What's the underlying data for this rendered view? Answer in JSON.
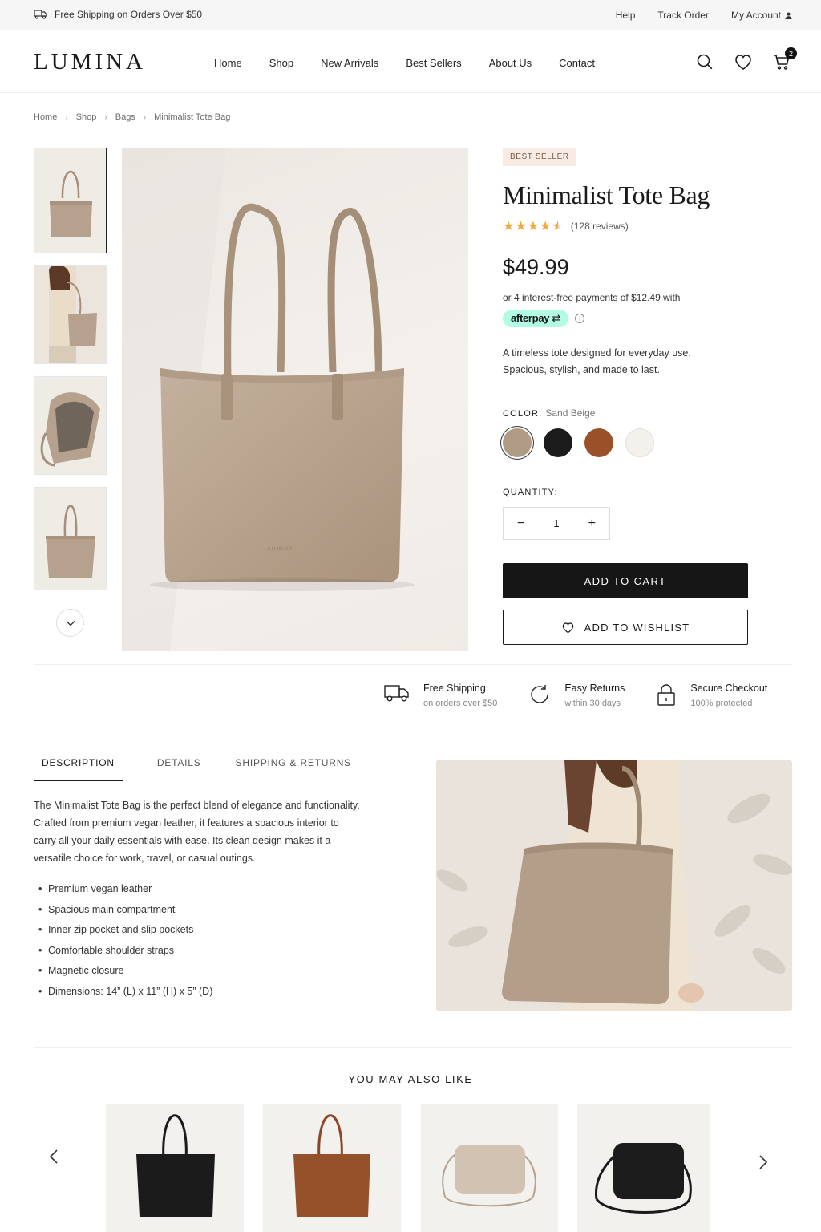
{
  "topbar": {
    "shipping_text": "Free Shipping on Orders Over $50",
    "links": [
      "Help",
      "Track Order",
      "My Account"
    ]
  },
  "header": {
    "logo": "LUMINA",
    "nav": [
      "Home",
      "Shop",
      "New Arrivals",
      "Best Sellers",
      "About Us",
      "Contact"
    ],
    "cart_count": "2"
  },
  "breadcrumb": [
    "Home",
    "Shop",
    "Bags",
    "Minimalist Tote Bag"
  ],
  "product": {
    "badge": "BEST SELLER",
    "title": "Minimalist Tote Bag",
    "rating": 4.5,
    "reviews": "(128 reviews)",
    "price": "$49.99",
    "payments": "or 4 interest-free payments of $12.49 with",
    "afterpay_label": "afterpay",
    "description_line1": "A timeless tote designed for everyday use.",
    "description_line2": "Spacious, stylish, and made to last.",
    "color_label": "COLOR:",
    "color_value": "Sand Beige",
    "colors": [
      "#b09b86",
      "#1c1c1c",
      "#9a5028",
      "#f4f1ec"
    ],
    "quantity_label": "QUANTITY:",
    "quantity": "1",
    "add_to_cart": "ADD TO CART",
    "add_to_wishlist": "ADD TO WISHLIST",
    "bag_stamp": "LUMINA"
  },
  "features": [
    {
      "title": "Free Shipping",
      "sub": "on orders over $50",
      "icon": "truck-icon"
    },
    {
      "title": "Easy Returns",
      "sub": "within 30 days",
      "icon": "refresh-icon"
    },
    {
      "title": "Secure Checkout",
      "sub": "100% protected",
      "icon": "lock-icon"
    }
  ],
  "tabs": [
    "DESCRIPTION",
    "DETAILS",
    "SHIPPING & RETURNS"
  ],
  "long_description": [
    "The Minimalist Tote Bag is the perfect blend of elegance and functionality.",
    "Crafted from premium vegan leather, it features a spacious interior to",
    "carry all your daily essentials with ease. Its clean design makes it a",
    "versatile choice for work, travel, or casual outings."
  ],
  "bullets": [
    "Premium vegan leather",
    "Spacious main compartment",
    "Inner zip pocket and slip pockets",
    "Comfortable shoulder straps",
    "Magnetic closure",
    "Dimensions: 14” (L) x 11” (H) x 5” (D)"
  ],
  "also_like": {
    "title": "YOU MAY ALSO LIKE"
  },
  "colors": {
    "bag_beige": "#b5a18d",
    "accent_star": "#f2a93b",
    "afterpay_mint": "#b2fce4",
    "dark": "#161616"
  }
}
